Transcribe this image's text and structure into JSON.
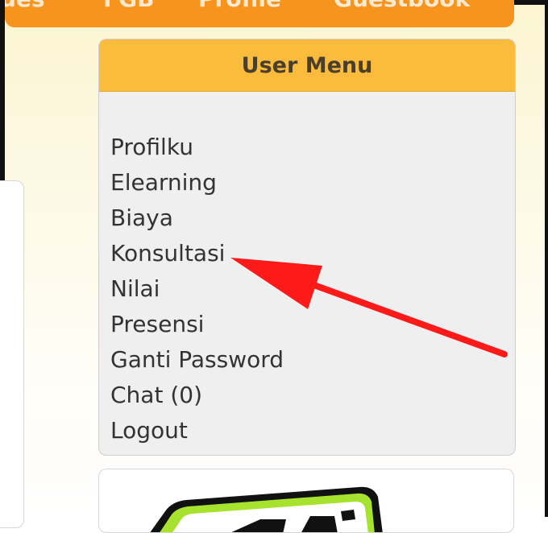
{
  "top_nav": {
    "items": [
      "ues",
      "FGB",
      "Profile",
      "Guestbook"
    ]
  },
  "user_menu": {
    "title": "User Menu",
    "items": [
      {
        "label": "Profilku"
      },
      {
        "label": "Elearning"
      },
      {
        "label": "Biaya"
      },
      {
        "label": "Konsultasi"
      },
      {
        "label": "Nilai"
      },
      {
        "label": "Presensi"
      },
      {
        "label": "Ganti Password"
      },
      {
        "label": "Chat (0)"
      },
      {
        "label": "Logout"
      }
    ]
  },
  "colors": {
    "nav_orange": "#f7941d",
    "menu_header": "#fbbb3d",
    "annotation_arrow": "#ff1a1a",
    "banner_green": "#a6e22e"
  }
}
